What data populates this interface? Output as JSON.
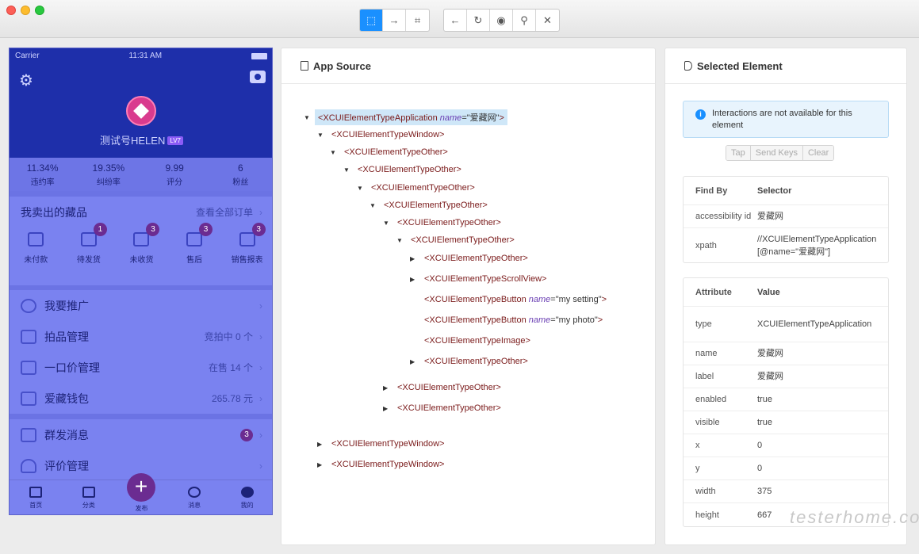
{
  "toolbar": {
    "group1": [
      "select-icon",
      "swipe-icon",
      "screenshot-icon"
    ],
    "group2": [
      "back-icon",
      "refresh-icon",
      "eye-icon",
      "search-icon",
      "close-icon"
    ]
  },
  "phone": {
    "carrier": "Carrier",
    "time": "11:31 AM",
    "nickname": "测试号HELEN",
    "level": "LV7",
    "stats": [
      {
        "value": "11.34%",
        "label": "违约率"
      },
      {
        "value": "19.35%",
        "label": "纠纷率"
      },
      {
        "value": "9.99",
        "label": "评分"
      },
      {
        "value": "6",
        "label": "粉丝"
      }
    ],
    "sold": {
      "title": "我卖出的藏品",
      "link": "查看全部订单"
    },
    "orders": [
      {
        "label": "未付款",
        "badge": ""
      },
      {
        "label": "待发货",
        "badge": "1"
      },
      {
        "label": "未收货",
        "badge": "3"
      },
      {
        "label": "售后",
        "badge": "3"
      },
      {
        "label": "销售报表",
        "badge": "3"
      }
    ],
    "menu1": [
      {
        "label": "我要推广",
        "value": ""
      },
      {
        "label": "拍品管理",
        "value": "竞拍中 0 个"
      },
      {
        "label": "一口价管理",
        "value": "在售 14 个"
      },
      {
        "label": "爱藏钱包",
        "value": "265.78 元"
      }
    ],
    "menu2": [
      {
        "label": "群发消息",
        "badge": "3"
      },
      {
        "label": "评价管理",
        "badge": ""
      }
    ],
    "tabs": [
      "首页",
      "分类",
      "发布",
      "消息",
      "我的"
    ]
  },
  "source": {
    "title": "App Source",
    "nodes": [
      {
        "tag": "<XCUIElementTypeApplication ",
        "attr": "name",
        "val": "=\"爱藏网\"",
        "close": ">",
        "arrow": "▼"
      },
      {
        "tag": "<XCUIElementTypeWindow>",
        "arrow": "▼"
      },
      {
        "tag": "<XCUIElementTypeOther>",
        "arrow": "▼"
      },
      {
        "tag": "<XCUIElementTypeOther>",
        "arrow": "▼"
      },
      {
        "tag": "<XCUIElementTypeOther>",
        "arrow": "▼"
      },
      {
        "tag": "<XCUIElementTypeOther>",
        "arrow": "▼"
      },
      {
        "tag": "<XCUIElementTypeOther>",
        "arrow": "▼"
      },
      {
        "tag": "<XCUIElementTypeOther>",
        "arrow": "▼"
      },
      {
        "tag": "<XCUIElementTypeOther>",
        "arrow": "▶"
      },
      {
        "tag": "<XCUIElementTypeScrollView>",
        "arrow": "▶"
      },
      {
        "tag": "<XCUIElementTypeButton ",
        "attr": "name",
        "val": "=\"my setting\"",
        "close": ">",
        "arrow": ""
      },
      {
        "tag": "<XCUIElementTypeButton ",
        "attr": "name",
        "val": "=\"my photo\"",
        "close": ">",
        "arrow": ""
      },
      {
        "tag": "<XCUIElementTypeImage>",
        "arrow": ""
      },
      {
        "tag": "<XCUIElementTypeOther>",
        "arrow": "▶"
      },
      {
        "tag": "<XCUIElementTypeOther>",
        "arrow": "▶"
      },
      {
        "tag": "<XCUIElementTypeOther>",
        "arrow": "▶"
      },
      {
        "tag": "<XCUIElementTypeWindow>",
        "arrow": "▶"
      },
      {
        "tag": "<XCUIElementTypeWindow>",
        "arrow": "▶"
      }
    ]
  },
  "selected": {
    "title": "Selected Element",
    "info": "Interactions are not available for this element",
    "buttons": [
      "Tap",
      "Send Keys",
      "Clear"
    ],
    "findby_header": [
      "Find By",
      "Selector"
    ],
    "findby": [
      {
        "k": "accessibility id",
        "v": "爱藏网"
      },
      {
        "k": "xpath",
        "v": "//XCUIElementTypeApplication[@name=\"爱藏网\"]"
      }
    ],
    "attr_header": [
      "Attribute",
      "Value"
    ],
    "attrs": [
      {
        "k": "type",
        "v": "XCUIElementTypeApplication"
      },
      {
        "k": "name",
        "v": "爱藏网"
      },
      {
        "k": "label",
        "v": "爱藏网"
      },
      {
        "k": "enabled",
        "v": "true"
      },
      {
        "k": "visible",
        "v": "true"
      },
      {
        "k": "x",
        "v": "0"
      },
      {
        "k": "y",
        "v": "0"
      },
      {
        "k": "width",
        "v": "375"
      },
      {
        "k": "height",
        "v": "667"
      }
    ]
  },
  "watermark": "testerhome.com"
}
